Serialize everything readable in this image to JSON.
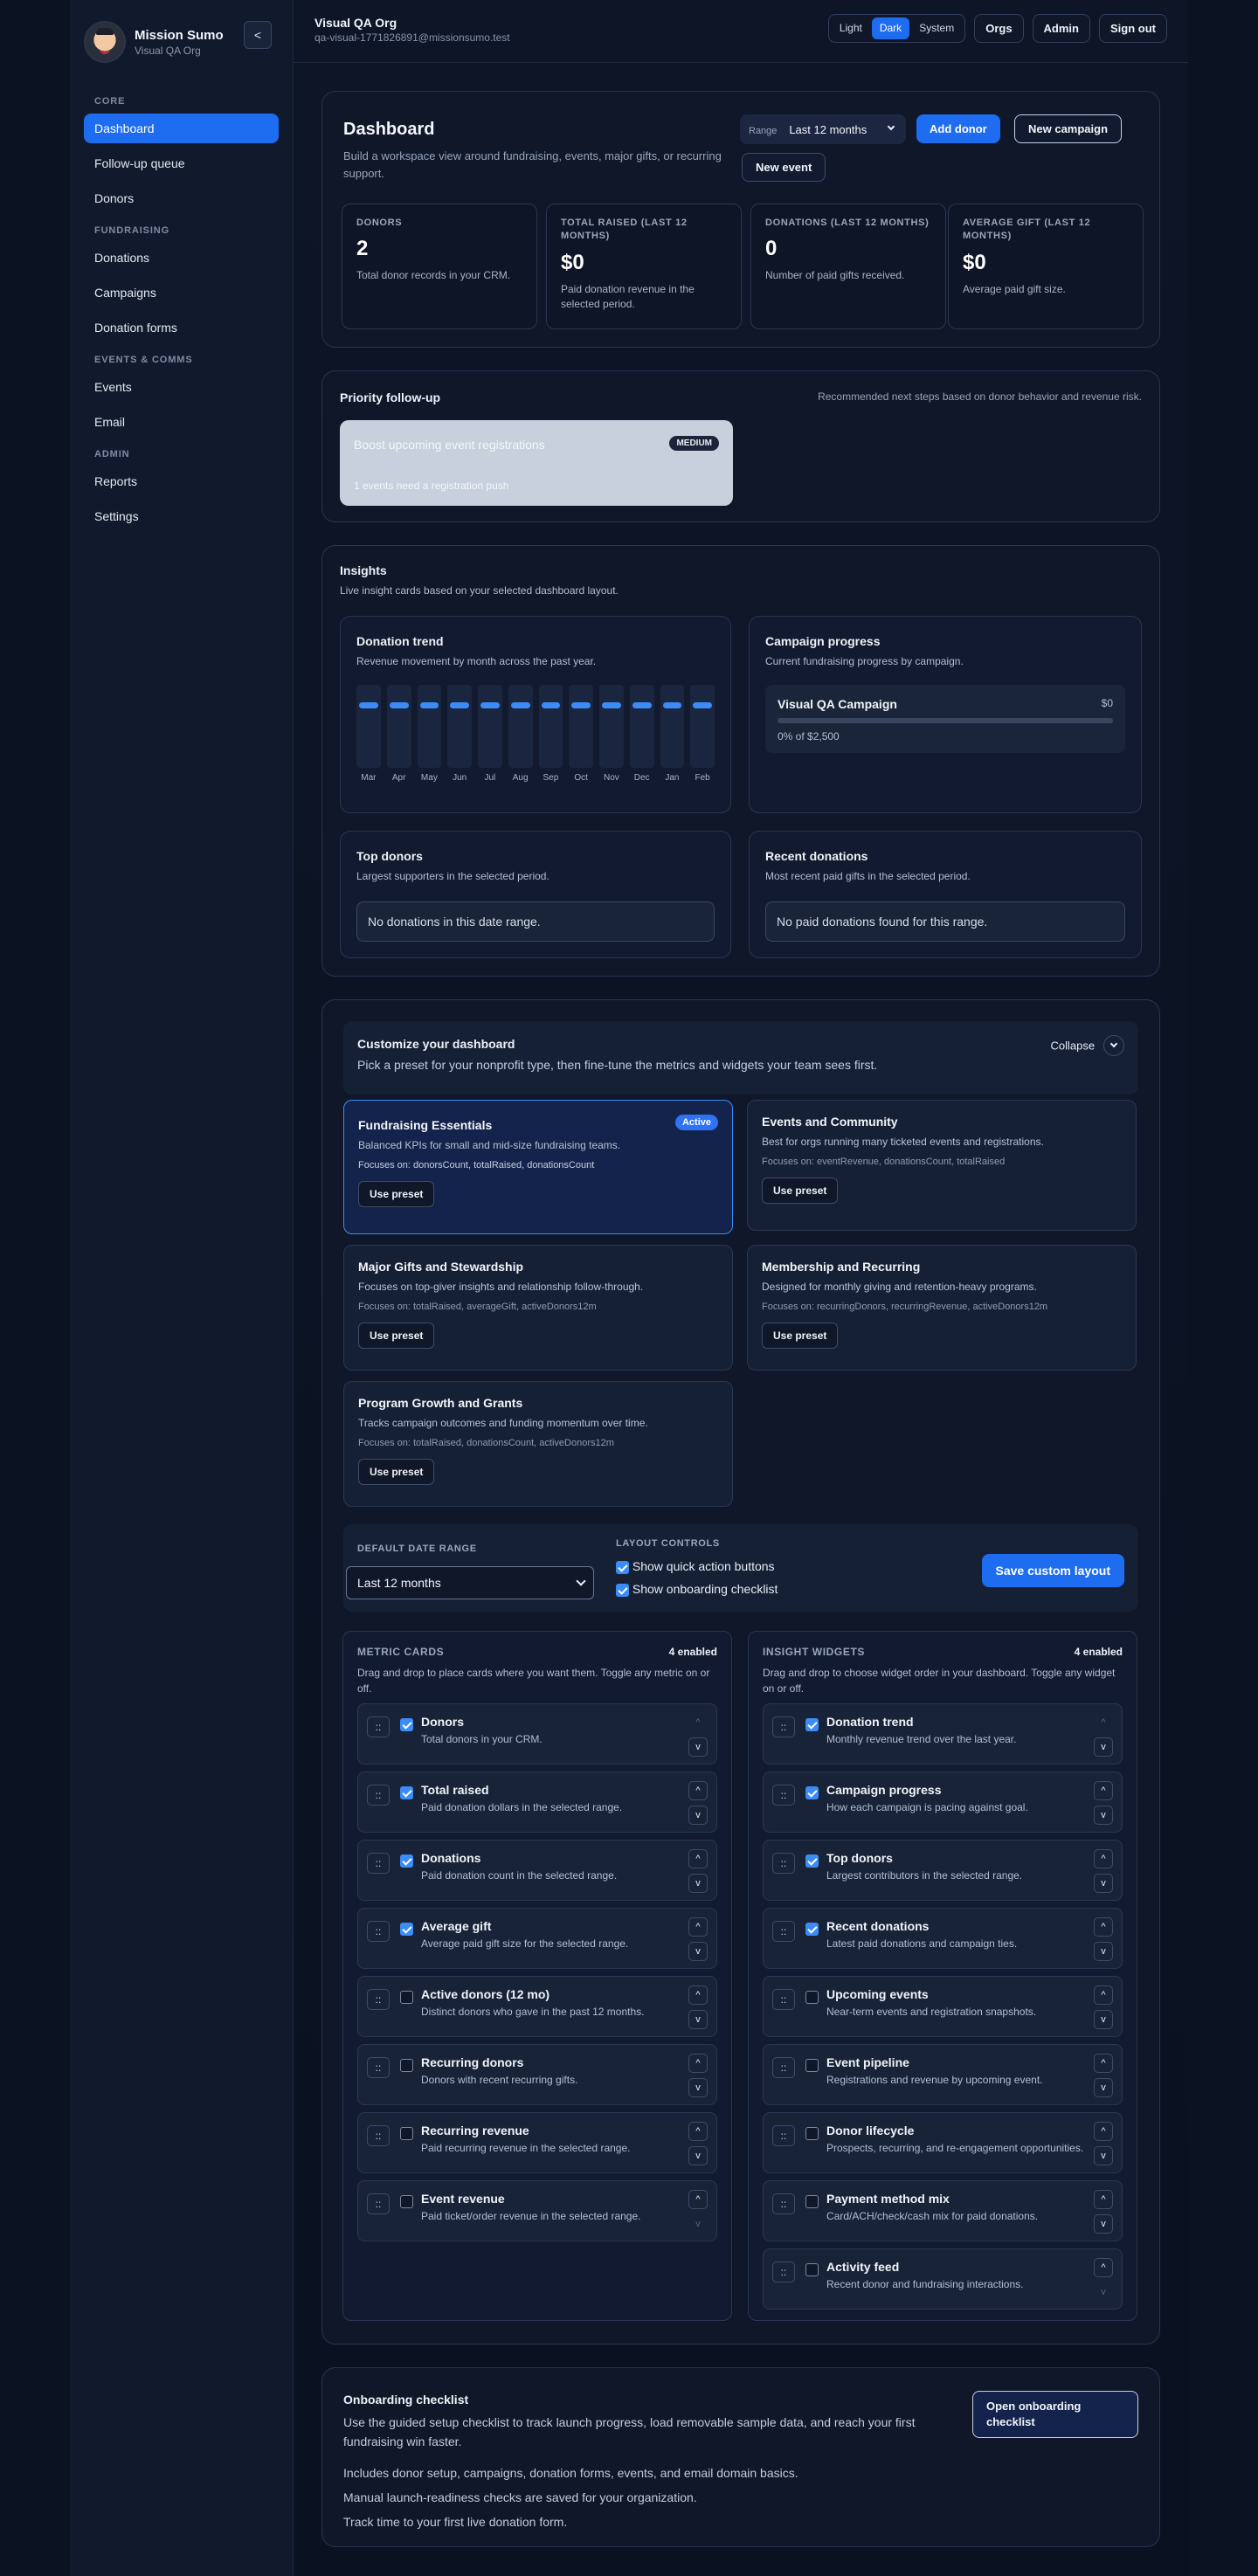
{
  "sidebar": {
    "brand": {
      "name": "Mission Sumo",
      "org": "Visual QA Org"
    },
    "collapse_label": "<",
    "sections": [
      {
        "label": "CORE",
        "items": [
          "Dashboard",
          "Follow-up queue",
          "Donors"
        ]
      },
      {
        "label": "FUNDRAISING",
        "items": [
          "Donations",
          "Campaigns",
          "Donation forms"
        ]
      },
      {
        "label": "EVENTS & COMMS",
        "items": [
          "Events",
          "Email"
        ]
      },
      {
        "label": "ADMIN",
        "items": [
          "Reports",
          "Settings"
        ]
      }
    ],
    "active_item": "Dashboard"
  },
  "topbar": {
    "org_title": "Visual QA Org",
    "org_email": "qa-visual-1771826891@missionsumo.test",
    "theme": {
      "light": "Light",
      "dark": "Dark",
      "system": "System",
      "active": "Dark"
    },
    "orgs": "Orgs",
    "admin": "Admin",
    "signout": "Sign out"
  },
  "dashboard": {
    "title": "Dashboard",
    "subtitle": "Build a workspace view around fundraising, events, major gifts, or recurring support.",
    "range_label": "Range",
    "range_value": "Last 12 months",
    "add_donor": "Add donor",
    "new_campaign": "New campaign",
    "new_event": "New event",
    "stats": [
      {
        "label": "DONORS",
        "value": "2",
        "desc": "Total donor records in your CRM."
      },
      {
        "label": "TOTAL RAISED (LAST 12 MONTHS)",
        "value": "$0",
        "desc": "Paid donation revenue in the selected period."
      },
      {
        "label": "DONATIONS (LAST 12 MONTHS)",
        "value": "0",
        "desc": "Number of paid gifts received."
      },
      {
        "label": "AVERAGE GIFT (LAST 12 MONTHS)",
        "value": "$0",
        "desc": "Average paid gift size."
      }
    ]
  },
  "priority": {
    "title": "Priority follow-up",
    "hint": "Recommended next steps based on donor behavior and revenue risk.",
    "card_title": "Boost upcoming event registrations",
    "card_badge": "MEDIUM",
    "card_desc": "1 events need a registration push"
  },
  "insights": {
    "title": "Insights",
    "subtitle": "Live insight cards based on your selected dashboard layout.",
    "trend_title": "Donation trend",
    "trend_sub": "Revenue movement by month across the past year.",
    "campaign_title": "Campaign progress",
    "campaign_sub": "Current fundraising progress by campaign.",
    "campaign_name": "Visual QA Campaign",
    "campaign_amount": "$0",
    "campaign_progress": "0% of $2,500",
    "campaign_fraction": 0,
    "top_title": "Top donors",
    "top_sub": "Largest supporters in the selected period.",
    "top_empty": "No donations in this date range.",
    "recent_title": "Recent donations",
    "recent_sub": "Most recent paid gifts in the selected period.",
    "recent_empty": "No paid donations found for this range."
  },
  "chart_data": {
    "type": "bar",
    "categories": [
      "Mar",
      "Apr",
      "May",
      "Jun",
      "Jul",
      "Aug",
      "Sep",
      "Oct",
      "Nov",
      "Dec",
      "Jan",
      "Feb"
    ],
    "values": [
      0,
      0,
      0,
      0,
      0,
      0,
      0,
      0,
      0,
      0,
      0,
      0
    ],
    "title": "Donation trend",
    "xlabel": "",
    "ylabel": ""
  },
  "customize": {
    "title": "Customize your dashboard",
    "subtitle": "Pick a preset for your nonprofit type, then fine-tune the metrics and widgets your team sees first.",
    "collapse": "Collapse",
    "presets": [
      {
        "title": "Fundraising Essentials",
        "desc": "Balanced KPIs for small and mid-size fundraising teams.",
        "focus": "Focuses on: donorsCount, totalRaised, donationsCount",
        "btn": "Use preset",
        "badge": "Active"
      },
      {
        "title": "Events and Community",
        "desc": "Best for orgs running many ticketed events and registrations.",
        "focus": "Focuses on: eventRevenue, donationsCount, totalRaised",
        "btn": "Use preset"
      },
      {
        "title": "Major Gifts and Stewardship",
        "desc": "Focuses on top-giver insights and relationship follow-through.",
        "focus": "Focuses on: totalRaised, averageGift, activeDonors12m",
        "btn": "Use preset"
      },
      {
        "title": "Membership and Recurring",
        "desc": "Designed for monthly giving and retention-heavy programs.",
        "focus": "Focuses on: recurringDonors, recurringRevenue, activeDonors12m",
        "btn": "Use preset"
      },
      {
        "title": "Program Growth and Grants",
        "desc": "Tracks campaign outcomes and funding momentum over time.",
        "focus": "Focuses on: totalRaised, donationsCount, activeDonors12m",
        "btn": "Use preset"
      }
    ],
    "date_range_label": "DEFAULT DATE RANGE",
    "date_range_value": "Last 12 months",
    "layout_label": "LAYOUT CONTROLS",
    "opt_quick": "Show quick action buttons",
    "opt_onboarding": "Show onboarding checklist",
    "save": "Save custom layout",
    "metrics": {
      "title": "METRIC CARDS",
      "count": "4 enabled",
      "desc": "Drag and drop to place cards where you want them. Toggle any metric on or off.",
      "items": [
        {
          "title": "Donors",
          "desc": "Total donors in your CRM.",
          "on": true
        },
        {
          "title": "Total raised",
          "desc": "Paid donation dollars in the selected range.",
          "on": true
        },
        {
          "title": "Donations",
          "desc": "Paid donation count in the selected range.",
          "on": true
        },
        {
          "title": "Average gift",
          "desc": "Average paid gift size for the selected range.",
          "on": true
        },
        {
          "title": "Active donors (12 mo)",
          "desc": "Distinct donors who gave in the past 12 months.",
          "on": false
        },
        {
          "title": "Recurring donors",
          "desc": "Donors with recent recurring gifts.",
          "on": false
        },
        {
          "title": "Recurring revenue",
          "desc": "Paid recurring revenue in the selected range.",
          "on": false
        },
        {
          "title": "Event revenue",
          "desc": "Paid ticket/order revenue in the selected range.",
          "on": false
        }
      ]
    },
    "widgets": {
      "title": "INSIGHT WIDGETS",
      "count": "4 enabled",
      "desc": "Drag and drop to choose widget order in your dashboard. Toggle any widget on or off.",
      "items": [
        {
          "title": "Donation trend",
          "desc": "Monthly revenue trend over the last year.",
          "on": true
        },
        {
          "title": "Campaign progress",
          "desc": "How each campaign is pacing against goal.",
          "on": true
        },
        {
          "title": "Top donors",
          "desc": "Largest contributors in the selected range.",
          "on": true
        },
        {
          "title": "Recent donations",
          "desc": "Latest paid donations and campaign ties.",
          "on": true
        },
        {
          "title": "Upcoming events",
          "desc": "Near-term events and registration snapshots.",
          "on": false
        },
        {
          "title": "Event pipeline",
          "desc": "Registrations and revenue by upcoming event.",
          "on": false
        },
        {
          "title": "Donor lifecycle",
          "desc": "Prospects, recurring, and re-engagement opportunities.",
          "on": false
        },
        {
          "title": "Payment method mix",
          "desc": "Card/ACH/check/cash mix for paid donations.",
          "on": false
        },
        {
          "title": "Activity feed",
          "desc": "Recent donor and fundraising interactions.",
          "on": false
        }
      ]
    }
  },
  "onboarding": {
    "title": "Onboarding checklist",
    "desc": "Use the guided setup checklist to track launch progress, load removable sample data, and reach your first fundraising win faster.",
    "line1": "Includes donor setup, campaigns, donation forms, events, and email domain basics.",
    "line2": "Manual launch-readiness checks are saved for your organization.",
    "line3": "Track time to your first live donation form.",
    "button": "Open onboarding checklist"
  },
  "icons": {
    "drag": "drag-handle-icon",
    "up": "chevron-up-icon",
    "down": "chevron-down-icon",
    "check": "checkbox-icon"
  },
  "colors": {
    "accent": "#1e6cf0",
    "bg": "#0b1221",
    "card": "#0f1729"
  }
}
